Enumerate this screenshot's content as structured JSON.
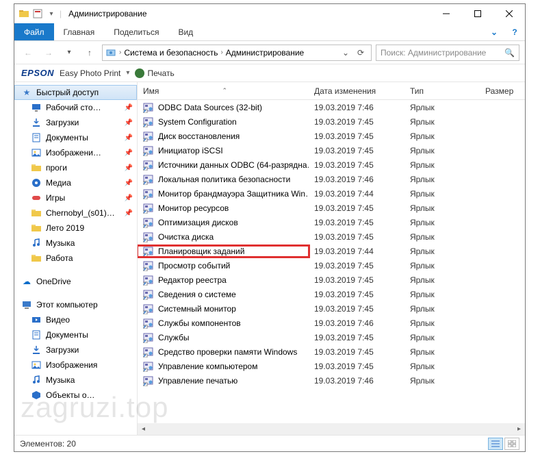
{
  "window": {
    "title": "Администрирование"
  },
  "ribbon": {
    "file": "Файл",
    "tabs": [
      "Главная",
      "Поделиться",
      "Вид"
    ]
  },
  "breadcrumbs": {
    "items": [
      "Система и безопасность",
      "Администрирование"
    ]
  },
  "search": {
    "placeholder": "Поиск: Администрирование"
  },
  "epson": {
    "logo": "EPSON",
    "text": "Easy Photo Print",
    "print": "Печать"
  },
  "columns": {
    "name": "Имя",
    "date": "Дата изменения",
    "type": "Тип",
    "size": "Размер"
  },
  "sidebar": {
    "quick": "Быстрый доступ",
    "items": [
      {
        "label": "Рабочий сто…",
        "icon": "desktop",
        "color": "#2a6fc9",
        "pinned": true
      },
      {
        "label": "Загрузки",
        "icon": "download",
        "color": "#2a6fc9",
        "pinned": true
      },
      {
        "label": "Документы",
        "icon": "document",
        "color": "#2a6fc9",
        "pinned": true
      },
      {
        "label": "Изображени…",
        "icon": "picture",
        "color": "#2a6fc9",
        "pinned": true
      },
      {
        "label": "проги",
        "icon": "folder",
        "color": "#f0c84a",
        "pinned": true
      },
      {
        "label": "Медиа",
        "icon": "media",
        "color": "#2a6fc9",
        "pinned": true
      },
      {
        "label": "Игры",
        "icon": "games",
        "color": "#e04a4a",
        "pinned": true
      },
      {
        "label": "Chernobyl_(s01)…",
        "icon": "folder",
        "color": "#f0c84a",
        "pinned": true
      },
      {
        "label": "Лето 2019",
        "icon": "folder",
        "color": "#f0c84a",
        "pinned": false
      },
      {
        "label": "Музыка",
        "icon": "music",
        "color": "#2a6fc9",
        "pinned": false
      },
      {
        "label": "Работа",
        "icon": "folder",
        "color": "#f0c84a",
        "pinned": false
      }
    ],
    "onedrive": "OneDrive",
    "thispc": "Этот компьютер",
    "pcitems": [
      {
        "label": "Видео",
        "icon": "video"
      },
      {
        "label": "Документы",
        "icon": "document"
      },
      {
        "label": "Загрузки",
        "icon": "download"
      },
      {
        "label": "Изображения",
        "icon": "picture"
      },
      {
        "label": "Музыка",
        "icon": "music"
      },
      {
        "label": "Объекты о…",
        "icon": "object"
      }
    ]
  },
  "files": [
    {
      "name": "ODBC Data Sources (32-bit)",
      "date": "19.03.2019 7:46",
      "type": "Ярлык"
    },
    {
      "name": "System Configuration",
      "date": "19.03.2019 7:45",
      "type": "Ярлык"
    },
    {
      "name": "Диск восстановления",
      "date": "19.03.2019 7:45",
      "type": "Ярлык"
    },
    {
      "name": "Инициатор iSCSI",
      "date": "19.03.2019 7:45",
      "type": "Ярлык"
    },
    {
      "name": "Источники данных ODBC (64-разрядна…",
      "date": "19.03.2019 7:45",
      "type": "Ярлык"
    },
    {
      "name": "Локальная политика безопасности",
      "date": "19.03.2019 7:46",
      "type": "Ярлык"
    },
    {
      "name": "Монитор брандмауэра Защитника Win…",
      "date": "19.03.2019 7:44",
      "type": "Ярлык"
    },
    {
      "name": "Монитор ресурсов",
      "date": "19.03.2019 7:45",
      "type": "Ярлык"
    },
    {
      "name": "Оптимизация дисков",
      "date": "19.03.2019 7:45",
      "type": "Ярлык"
    },
    {
      "name": "Очистка диска",
      "date": "19.03.2019 7:45",
      "type": "Ярлык"
    },
    {
      "name": "Планировщик заданий",
      "date": "19.03.2019 7:44",
      "type": "Ярлык",
      "highlight": true
    },
    {
      "name": "Просмотр событий",
      "date": "19.03.2019 7:45",
      "type": "Ярлык"
    },
    {
      "name": "Редактор реестра",
      "date": "19.03.2019 7:45",
      "type": "Ярлык"
    },
    {
      "name": "Сведения о системе",
      "date": "19.03.2019 7:45",
      "type": "Ярлык"
    },
    {
      "name": "Системный монитор",
      "date": "19.03.2019 7:45",
      "type": "Ярлык"
    },
    {
      "name": "Службы компонентов",
      "date": "19.03.2019 7:46",
      "type": "Ярлык"
    },
    {
      "name": "Службы",
      "date": "19.03.2019 7:45",
      "type": "Ярлык"
    },
    {
      "name": "Средство проверки памяти Windows",
      "date": "19.03.2019 7:45",
      "type": "Ярлык"
    },
    {
      "name": "Управление компьютером",
      "date": "19.03.2019 7:45",
      "type": "Ярлык"
    },
    {
      "name": "Управление печатью",
      "date": "19.03.2019 7:46",
      "type": "Ярлык"
    }
  ],
  "status": {
    "count_label": "Элементов: 20"
  },
  "watermark": "zagruzi.top"
}
